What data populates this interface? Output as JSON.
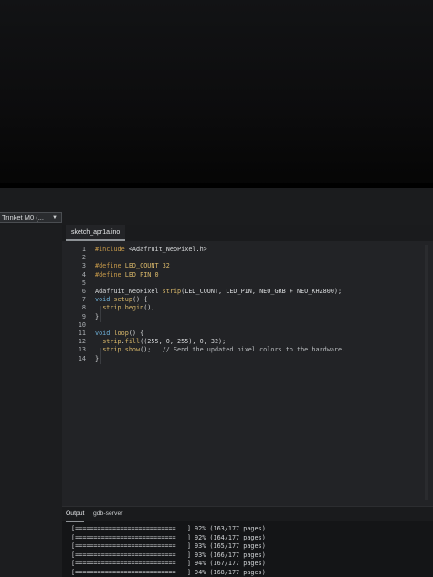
{
  "toolbar": {
    "board_select_label": "Trinket M0 (...",
    "board_select_chevron": "chevron-down-icon"
  },
  "tabs": [
    {
      "label": "sketch_apr1a.ino"
    }
  ],
  "editor": {
    "lines": [
      {
        "n": "1",
        "text": "#include <Adafruit_NeoPixel.h>"
      },
      {
        "n": "2",
        "text": ""
      },
      {
        "n": "3",
        "text": "#define LED_COUNT 32"
      },
      {
        "n": "4",
        "text": "#define LED_PIN 0"
      },
      {
        "n": "5",
        "text": ""
      },
      {
        "n": "6",
        "text": "Adafruit_NeoPixel strip(LED_COUNT, LED_PIN, NEO_GRB + NEO_KHZ800);"
      },
      {
        "n": "7",
        "text": "void setup() {"
      },
      {
        "n": "8",
        "text": "  strip.begin();"
      },
      {
        "n": "9",
        "text": "}"
      },
      {
        "n": "10",
        "text": ""
      },
      {
        "n": "11",
        "text": "void loop() {"
      },
      {
        "n": "12",
        "text": "  strip.fill((255, 0, 255), 0, 32);"
      },
      {
        "n": "13",
        "text": "  strip.show();   // Send the updated pixel colors to the hardware."
      },
      {
        "n": "14",
        "text": "}"
      }
    ]
  },
  "output": {
    "tabs": [
      "Output",
      "gdb-server"
    ],
    "lines": [
      "[===========================   ] 92% (163/177 pages)",
      "[===========================   ] 92% (164/177 pages)",
      "[===========================   ] 93% (165/177 pages)",
      "[===========================   ] 93% (166/177 pages)",
      "[===========================   ] 94% (167/177 pages)",
      "[===========================   ] 94% (168/177 pages)"
    ]
  },
  "colors": {
    "keyword": "#c79a4a",
    "function": "#6fb1d8",
    "constant": "#d9b86a",
    "background": "#222326"
  }
}
